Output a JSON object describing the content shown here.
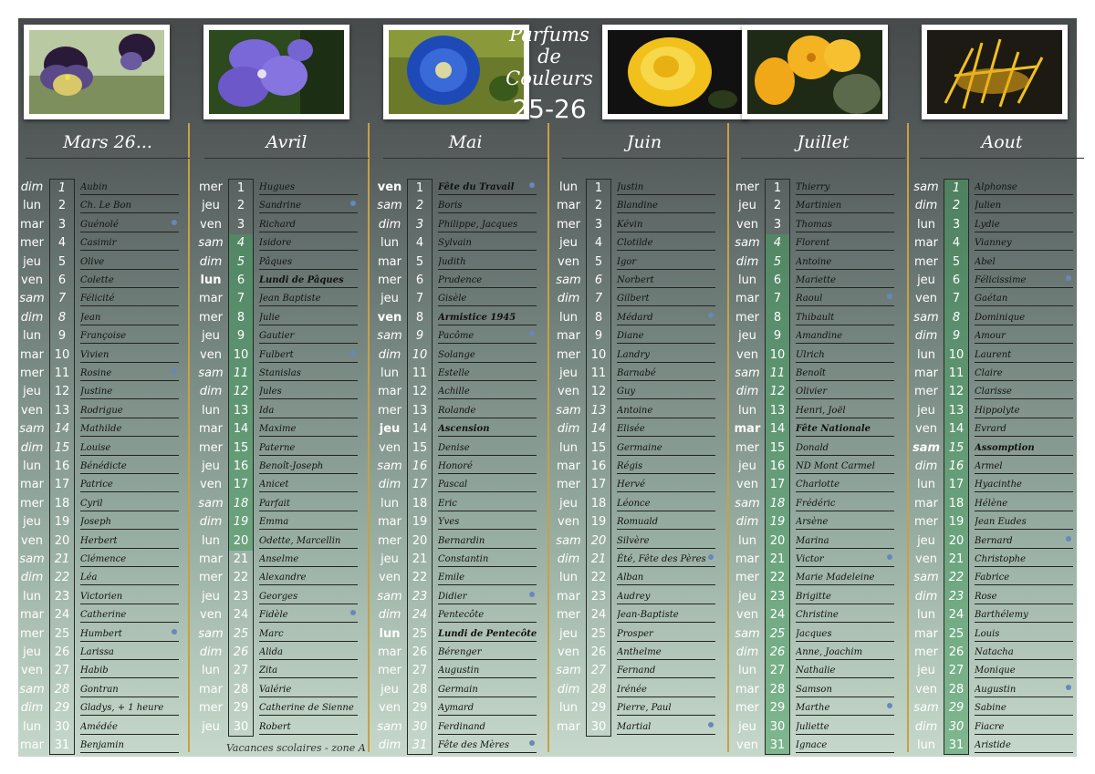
{
  "title": {
    "line1": "Parfums de",
    "line2": "Couleurs",
    "year": "25-26"
  },
  "footer": "Vacances scolaires - zone A",
  "photos": [
    {
      "name": "pansy-photo"
    },
    {
      "name": "orchid-photo"
    },
    {
      "name": "morning-glory-photo"
    },
    {
      "name": "yellow-rose-photo"
    },
    {
      "name": "allamanda-photo"
    },
    {
      "name": "ginger-lily-photo"
    }
  ],
  "months": [
    {
      "name": "Mars 26...",
      "first_dow": 0,
      "names": [
        "Aubin",
        "Ch. Le Bon",
        "Guénolé",
        "Casimir",
        "Olive",
        "Colette",
        "Félicité",
        "Jean",
        "Françoise",
        "Vivien",
        "Rosine",
        "Justine",
        "Rodrigue",
        "Mathilde",
        "Louise",
        "Bénédicte",
        "Patrice",
        "Cyril",
        "Joseph",
        "Herbert",
        "Clémence",
        "Léa",
        "Victorien",
        "Catherine",
        "Humbert",
        "Larissa",
        "Habib",
        "Gontran",
        "Gladys, + 1 heure",
        "Amédée",
        "Benjamin"
      ],
      "special": {},
      "school": [],
      "dots": [
        3,
        11,
        25
      ]
    },
    {
      "name": "Avril",
      "first_dow": 3,
      "names": [
        "Hugues",
        "Sandrine",
        "Richard",
        "Isidore",
        "Pâques",
        "Lundi de Pâques",
        "Jean Baptiste",
        "Julie",
        "Gautier",
        "Fulbert",
        "Stanislas",
        "Jules",
        "Ida",
        "Maxime",
        "Paterne",
        "Benoît-Joseph",
        "Anicet",
        "Parfait",
        "Emma",
        "Odette, Marcellin",
        "Anselme",
        "Alexandre",
        "Georges",
        "Fidèle",
        "Marc",
        "Alida",
        "Zita",
        "Valérie",
        "Catherine de Sienne",
        "Robert"
      ],
      "special": {
        "6": true
      },
      "school": [
        4,
        5,
        6,
        7,
        8,
        9,
        10,
        11,
        12,
        13,
        14,
        15,
        16,
        17,
        18,
        19,
        20
      ],
      "dots": [
        2,
        10,
        24
      ]
    },
    {
      "name": "Mai",
      "first_dow": 5,
      "names": [
        "Fête du Travail",
        "Boris",
        "Philippe, Jacques",
        "Sylvain",
        "Judith",
        "Prudence",
        "Gisèle",
        "Armistice 1945",
        "Pacôme",
        "Solange",
        "Estelle",
        "Achille",
        "Rolande",
        "Ascension",
        "Denise",
        "Honoré",
        "Pascal",
        "Eric",
        "Yves",
        "Bernardin",
        "Constantin",
        "Emile",
        "Didier",
        "Pentecôte",
        "Lundi de Pentecôte",
        "Bérenger",
        "Augustin",
        "Germain",
        "Aymard",
        "Ferdinand",
        "Fête des Mères"
      ],
      "special": {
        "1": true,
        "8": true,
        "14": true,
        "25": true
      },
      "school": [],
      "dots": [
        1,
        9,
        23,
        31
      ]
    },
    {
      "name": "Juin",
      "first_dow": 1,
      "names": [
        "Justin",
        "Blandine",
        "Kévin",
        "Clotilde",
        "Igor",
        "Norbert",
        "Gilbert",
        "Médard",
        "Diane",
        "Landry",
        "Barnabé",
        "Guy",
        "Antoine",
        "Elisée",
        "Germaine",
        "Régis",
        "Hervé",
        "Léonce",
        "Romuald",
        "Silvère",
        "Été, Fête des Pères",
        "Alban",
        "Audrey",
        "Jean-Baptiste",
        "Prosper",
        "Anthelme",
        "Fernand",
        "Irénée",
        "Pierre, Paul",
        "Martial"
      ],
      "special": {},
      "school": [],
      "dots": [
        8,
        21,
        30
      ]
    },
    {
      "name": "Juillet",
      "first_dow": 3,
      "names": [
        "Thierry",
        "Martinien",
        "Thomas",
        "Florent",
        "Antoine",
        "Mariette",
        "Raoul",
        "Thibault",
        "Amandine",
        "Ulrich",
        "Benoît",
        "Olivier",
        "Henri, Joël",
        "Fête Nationale",
        "Donald",
        "ND Mont Carmel",
        "Charlotte",
        "Frédéric",
        "Arsène",
        "Marina",
        "Victor",
        "Marie Madeleine",
        "Brigitte",
        "Christine",
        "Jacques",
        "Anne, Joachim",
        "Nathalie",
        "Samson",
        "Marthe",
        "Juliette",
        "Ignace"
      ],
      "special": {
        "14": true
      },
      "school": [
        4,
        5,
        6,
        7,
        8,
        9,
        10,
        11,
        12,
        13,
        14,
        15,
        16,
        17,
        18,
        19,
        20,
        21,
        22,
        23,
        24,
        25,
        26,
        27,
        28,
        29,
        30,
        31
      ],
      "dots": [
        7,
        21,
        29
      ]
    },
    {
      "name": "Aout",
      "first_dow": 6,
      "names": [
        "Alphonse",
        "Julien",
        "Lydie",
        "Vianney",
        "Abel",
        "Félicissime",
        "Gaétan",
        "Dominique",
        "Amour",
        "Laurent",
        "Claire",
        "Clarisse",
        "Hippolyte",
        "Evrard",
        "Assomption",
        "Armel",
        "Hyacinthe",
        "Hélène",
        "Jean Eudes",
        "Bernard",
        "Christophe",
        "Fabrice",
        "Rose",
        "Barthélemy",
        "Louis",
        "Natacha",
        "Monique",
        "Augustin",
        "Sabine",
        "Fiacre",
        "Aristide"
      ],
      "special": {
        "15": true
      },
      "school": [
        1,
        2,
        3,
        4,
        5,
        6,
        7,
        8,
        9,
        10,
        11,
        12,
        13,
        14,
        15,
        16,
        17,
        18,
        19,
        20,
        21,
        22,
        23,
        24,
        25,
        26,
        27,
        28,
        29,
        30,
        31
      ],
      "dots": [
        6,
        20,
        28
      ]
    }
  ],
  "weekdays": [
    "dim",
    "lun",
    "mar",
    "mer",
    "jeu",
    "ven",
    "sam"
  ],
  "colors": {
    "accent_gold": "#c8a044",
    "school_green": "#5aa876",
    "dot_blue": "#6688bb"
  }
}
